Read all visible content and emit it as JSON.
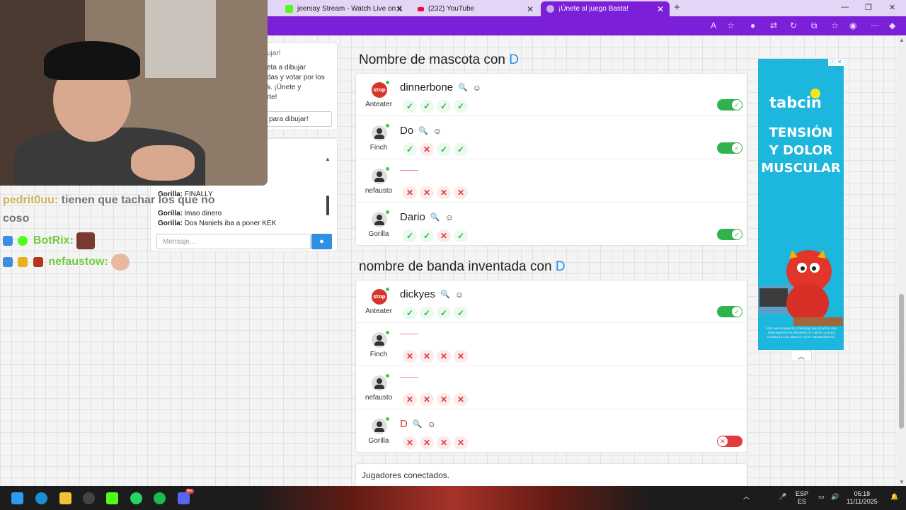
{
  "browser": {
    "tabs": [
      {
        "title": "jeersay Stream - Watch Live on K",
        "color": "#53fc18"
      },
      {
        "title": "(232) YouTube",
        "color": "#ff0033"
      },
      {
        "title": "¡Únete al juego Basta!",
        "color": "#7b1fd8"
      }
    ],
    "close_glyph": "✕",
    "new_tab_glyph": "+",
    "window_controls": [
      "—",
      "❐",
      "✕"
    ],
    "accent": "#7b1fd8"
  },
  "sections": [
    {
      "title": "Nombre de mascota con",
      "letter": "D",
      "rows": [
        {
          "player": "Anteater",
          "avatar": "stop",
          "answer": "dinnerbone",
          "votes": [
            "ok",
            "ok",
            "ok",
            "ok"
          ],
          "valid": true
        },
        {
          "player": "Finch",
          "avatar": "generic",
          "answer": "Do",
          "votes": [
            "ok",
            "no",
            "ok",
            "ok"
          ],
          "valid": true
        },
        {
          "player": "nefausto",
          "avatar": "generic",
          "answer": "",
          "votes": [
            "no",
            "no",
            "no",
            "no"
          ],
          "valid": null
        },
        {
          "player": "Gorilla",
          "avatar": "generic",
          "answer": "Dario",
          "votes": [
            "ok",
            "ok",
            "no",
            "ok"
          ],
          "valid": true
        }
      ]
    },
    {
      "title": "nombre de banda inventada con",
      "letter": "D",
      "rows": [
        {
          "player": "Anteater",
          "avatar": "stop",
          "answer": "dickyes",
          "votes": [
            "ok",
            "ok",
            "ok",
            "ok"
          ],
          "valid": true
        },
        {
          "player": "Finch",
          "avatar": "generic",
          "answer": "",
          "votes": [
            "no",
            "no",
            "no",
            "no"
          ],
          "valid": null
        },
        {
          "player": "nefausto",
          "avatar": "generic",
          "answer": "",
          "votes": [
            "no",
            "no",
            "no",
            "no"
          ],
          "valid": null
        },
        {
          "player": "Gorilla",
          "avatar": "generic",
          "answer": "D",
          "votes": [
            "no",
            "no",
            "no",
            "no"
          ],
          "valid": false
        }
      ]
    }
  ],
  "stop_badge": "stop",
  "vote_glyphs": {
    "ok": "✓",
    "no": "✕"
  },
  "footer": {
    "connected_label": "Jugadores conectados."
  },
  "ad": {
    "badge": "ⓘ ✕",
    "brand": "tabcin",
    "headline_1": "TENSIÓN",
    "headline_2": "Y DOLOR",
    "headline_3": "MUSCULAR",
    "fine_print": "ESTE MEDICAMENTO CONTIENE SALICILATOS. LEA ATENTAMENTE EL PROSPECTO Y ANTE LA DUDA CONSULTE A SU MÉDICO Y/O EL FARMACÉUTICO.",
    "collapse_glyph": "︿"
  },
  "left_panel": {
    "promo_title": "ujar!",
    "promo_text": "eta a dibujar\ndas y votar por los\ns. ¡Únete y\nrte!",
    "draw_button": "para dibujar!",
    "chat_lines": [
      {
        "user": "Gorilla:",
        "text": "FINALLY"
      },
      {
        "user": "Gorilla:",
        "text": "lmao dinero"
      },
      {
        "user": "Gorilla:",
        "text": "Dos Naniels iba a poner KEK"
      }
    ],
    "chat_placeholder": "Mensaje...",
    "send_glyph": "💬"
  },
  "stream_overlay": {
    "msg1_user": "pedrit0uu:",
    "msg1_text": "tienen que tachar los que no",
    "msg1_text2": "coso",
    "msg2_user": "BotRix:",
    "msg3_user": "nefaustow:"
  },
  "taskbar": {
    "lang_top": "ESP",
    "lang_bottom": "ES",
    "time": "05:18",
    "date": "11/11/2025",
    "badge_count": "9+"
  }
}
